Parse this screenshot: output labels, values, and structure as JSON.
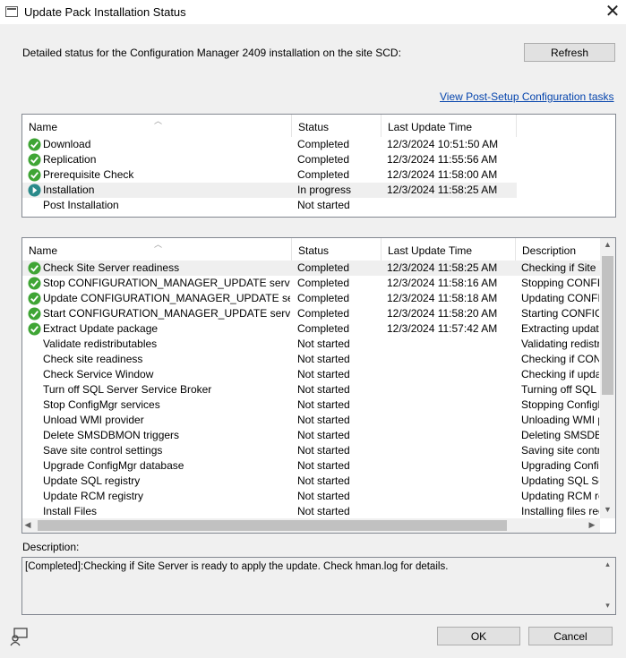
{
  "window": {
    "title": "Update Pack Installation Status",
    "close_glyph": "✕"
  },
  "intro_text": "Detailed status for the Configuration Manager 2409 installation on the site SCD:",
  "refresh_label": "Refresh",
  "link_text": "View Post-Setup Configuration tasks",
  "phases": {
    "headers": [
      "Name",
      "Status",
      "Last Update Time"
    ],
    "rows": [
      {
        "icon": "check-icon",
        "name": "Download",
        "status": "Completed",
        "time": "12/3/2024 10:51:50 AM"
      },
      {
        "icon": "check-icon",
        "name": "Replication",
        "status": "Completed",
        "time": "12/3/2024 11:55:56 AM"
      },
      {
        "icon": "check-icon",
        "name": "Prerequisite Check",
        "status": "Completed",
        "time": "12/3/2024 11:58:00 AM"
      },
      {
        "icon": "in-progress-icon",
        "name": "Installation",
        "status": "In progress",
        "time": "12/3/2024 11:58:25 AM"
      },
      {
        "icon": "",
        "name": "Post Installation",
        "status": "Not started",
        "time": ""
      }
    ]
  },
  "steps": {
    "headers": [
      "Name",
      "Status",
      "Last Update Time",
      "Description"
    ],
    "rows": [
      {
        "icon": "check-icon",
        "name": "Check Site Server readiness",
        "status": "Completed",
        "time": "12/3/2024 11:58:25 AM",
        "desc": "Checking if Site Se"
      },
      {
        "icon": "check-icon",
        "name": "Stop CONFIGURATION_MANAGER_UPDATE service",
        "status": "Completed",
        "time": "12/3/2024 11:58:16 AM",
        "desc": "Stopping CONFIGU"
      },
      {
        "icon": "check-icon",
        "name": "Update CONFIGURATION_MANAGER_UPDATE service",
        "status": "Completed",
        "time": "12/3/2024 11:58:18 AM",
        "desc": "Updating CONFIG"
      },
      {
        "icon": "check-icon",
        "name": "Start CONFIGURATION_MANAGER_UPDATE service",
        "status": "Completed",
        "time": "12/3/2024 11:58:20 AM",
        "desc": "Starting CONFIGU"
      },
      {
        "icon": "check-icon",
        "name": "Extract Update package",
        "status": "Completed",
        "time": "12/3/2024 11:57:42 AM",
        "desc": "Extracting update p"
      },
      {
        "icon": "",
        "name": "Validate redistributables",
        "status": "Not started",
        "time": "",
        "desc": "Validating redistrib"
      },
      {
        "icon": "",
        "name": "Check site readiness",
        "status": "Not started",
        "time": "",
        "desc": "Checking if CONFI"
      },
      {
        "icon": "",
        "name": "Check Service Window",
        "status": "Not started",
        "time": "",
        "desc": "Checking if update"
      },
      {
        "icon": "",
        "name": "Turn off SQL Server Service Broker",
        "status": "Not started",
        "time": "",
        "desc": "Turning off SQL Se"
      },
      {
        "icon": "",
        "name": "Stop ConfigMgr services",
        "status": "Not started",
        "time": "",
        "desc": "Stopping ConfigMg"
      },
      {
        "icon": "",
        "name": "Unload WMI provider",
        "status": "Not started",
        "time": "",
        "desc": "Unloading WMI pr"
      },
      {
        "icon": "",
        "name": "Delete SMSDBMON triggers",
        "status": "Not started",
        "time": "",
        "desc": "Deleting SMSDBM"
      },
      {
        "icon": "",
        "name": "Save site control settings",
        "status": "Not started",
        "time": "",
        "desc": "Saving site control"
      },
      {
        "icon": "",
        "name": "Upgrade ConfigMgr database",
        "status": "Not started",
        "time": "",
        "desc": "Upgrading ConfigM"
      },
      {
        "icon": "",
        "name": "Update SQL registry",
        "status": "Not started",
        "time": "",
        "desc": "Updating SQL Ser"
      },
      {
        "icon": "",
        "name": "Update RCM registry",
        "status": "Not started",
        "time": "",
        "desc": "Updating RCM reg"
      },
      {
        "icon": "",
        "name": "Install Files",
        "status": "Not started",
        "time": "",
        "desc": "Installing files requi"
      }
    ]
  },
  "description_label": "Description:",
  "description_text": "[Completed]:Checking if Site Server is ready to apply the update. Check hman.log for details.",
  "ok_label": "OK",
  "cancel_label": "Cancel",
  "colors": {
    "check_green": "#3fa535",
    "progress_teal": "#2a8a8a",
    "link_blue": "#0645ad"
  }
}
